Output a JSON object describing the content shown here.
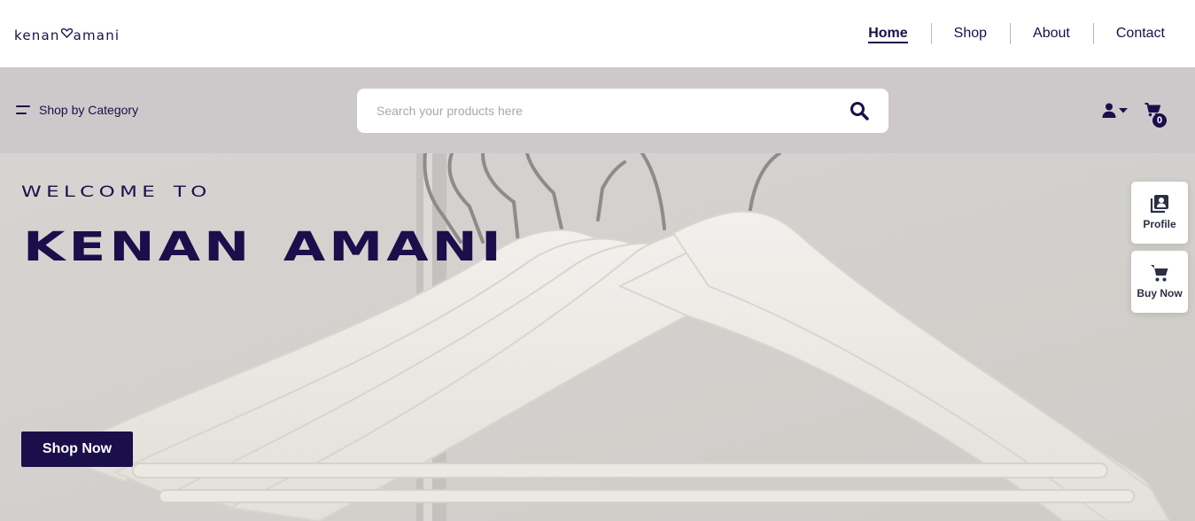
{
  "header": {
    "logo_left": "kenan",
    "logo_right": "amani",
    "nav": [
      {
        "label": "Home",
        "active": true
      },
      {
        "label": "Shop",
        "active": false
      },
      {
        "label": "About",
        "active": false
      },
      {
        "label": "Contact",
        "active": false
      }
    ]
  },
  "searchbar": {
    "category_label": "Shop by Category",
    "search_placeholder": "Search your products here",
    "cart_count": "0"
  },
  "hero": {
    "welcome": "welcome to",
    "title": "kenan amani",
    "cta_label": "Shop Now"
  },
  "side_actions": {
    "profile_label": "Profile",
    "buy_now_label": "Buy Now"
  },
  "colors": {
    "brand": "#1a0f4a",
    "strip_bg": "#cdc9ca",
    "hero_bg": "#d2d0cd"
  },
  "icons": [
    "heart-icon",
    "menu-icon",
    "search-icon",
    "user-icon",
    "caret-down-icon",
    "cart-icon",
    "profile-card-icon",
    "buy-cart-icon"
  ]
}
